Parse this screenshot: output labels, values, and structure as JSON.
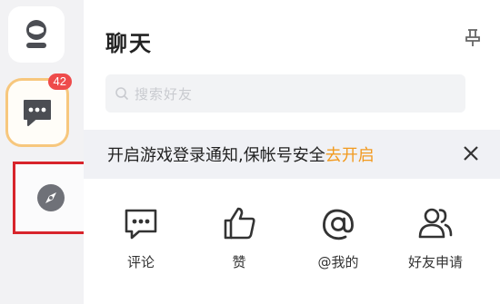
{
  "rail": {
    "chat_badge": "42"
  },
  "panel": {
    "title": "聊天",
    "search_placeholder": "搜索好友"
  },
  "notice": {
    "text": "开启游戏登录通知,保帐号安全",
    "link": "去开启"
  },
  "actions": [
    {
      "label": "评论",
      "icon": "comment-icon"
    },
    {
      "label": "赞",
      "icon": "thumbs-up-icon"
    },
    {
      "label": "@我的",
      "icon": "at-icon"
    },
    {
      "label": "好友申请",
      "icon": "friend-request-icon"
    }
  ],
  "colors": {
    "accent": "#f29a1f",
    "badge": "#ee4b4b",
    "highlight_border": "#d8242b",
    "icon": "#66686f"
  }
}
